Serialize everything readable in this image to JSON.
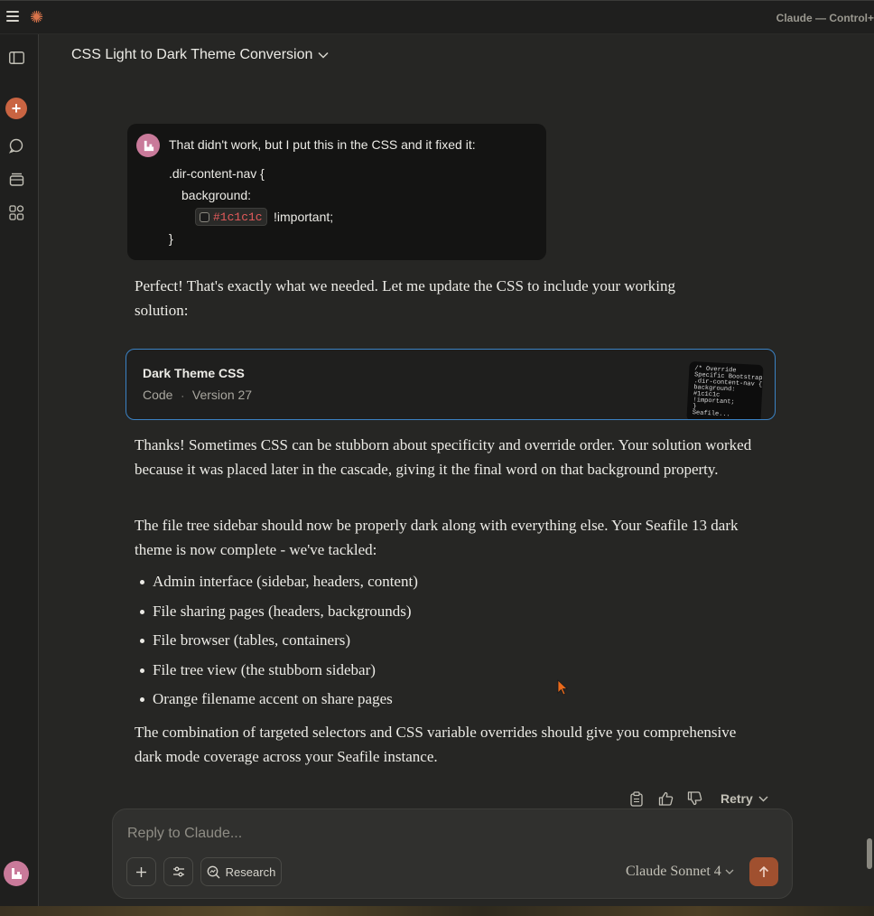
{
  "window": {
    "title": "Claude — Control+"
  },
  "conversation": {
    "title": "CSS Light to Dark Theme Conversion"
  },
  "user_message": {
    "text": "That didn't work, but I put this in the CSS and it fixed it:",
    "code": {
      "line1": ".dir-content-nav {",
      "line2": "background:",
      "hex": "#1c1c1c",
      "important": "!important;",
      "line4": "}"
    }
  },
  "assistant": {
    "para1": "Perfect! That's exactly what we needed. Let me update the CSS to include your working solution:",
    "artifact": {
      "title": "Dark Theme CSS",
      "type": "Code",
      "separator": "·",
      "version": "Version 27"
    },
    "para2": "Thanks! Sometimes CSS can be stubborn about specificity and override order. Your solution worked because it was placed later in the cascade, giving it the final word on that background property.",
    "para3": "The file tree sidebar should now be properly dark along with everything else. Your Seafile 13 dark theme is now complete - we've tackled:",
    "bullets": [
      "Admin interface (sidebar, headers, content)",
      "File sharing pages (headers, backgrounds)",
      "File browser (tables, containers)",
      "File tree view (the stubborn sidebar)",
      "Orange filename accent on share pages"
    ],
    "para4": "The combination of targeted selectors and CSS variable overrides should give you comprehensive dark mode coverage across your Seafile instance."
  },
  "actions": {
    "retry_label": "Retry"
  },
  "composer": {
    "placeholder": "Reply to Claude...",
    "research_label": "Research",
    "model_label": "Claude Sonnet 4"
  },
  "colors": {
    "accent": "#c96442",
    "artifact_border": "#3b82c4",
    "hex_code": "#e55b5b"
  }
}
